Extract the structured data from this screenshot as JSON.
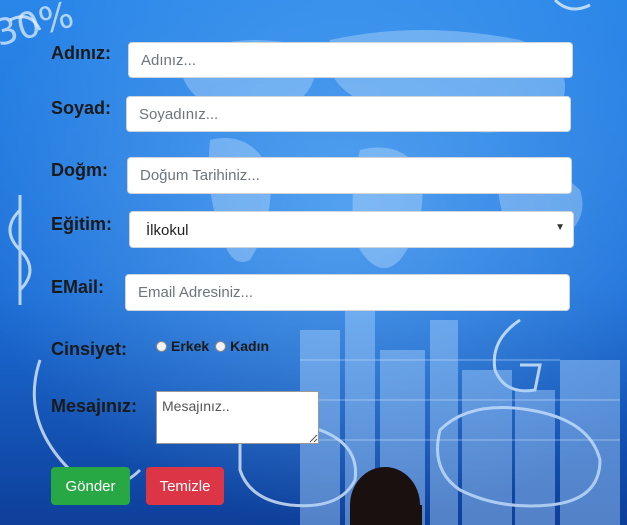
{
  "form": {
    "name": {
      "label": "Adınız:",
      "placeholder": "Adınız..."
    },
    "surname": {
      "label": "Soyad:",
      "placeholder": "Soyadınız..."
    },
    "birth": {
      "label": "Doğm:",
      "placeholder": "Doğum Tarihiniz..."
    },
    "education": {
      "label": "Eğitim:",
      "selected": "İlkokul"
    },
    "email": {
      "label": "EMail:",
      "placeholder": "Email Adresiniz..."
    },
    "gender": {
      "label": "Cinsiyet:",
      "options": [
        "Erkek",
        "Kadın"
      ]
    },
    "message": {
      "label": "Mesajınız:",
      "placeholder": "Mesajınız.."
    },
    "submit_label": "Gönder",
    "clear_label": "Temizle"
  },
  "background": {
    "text_fragment": "30%"
  },
  "colors": {
    "submit": "#28a745",
    "clear": "#dc3545",
    "bg_primary": "#1f6fd6"
  },
  "icons": {
    "select_arrow": "chevron-down-icon"
  }
}
